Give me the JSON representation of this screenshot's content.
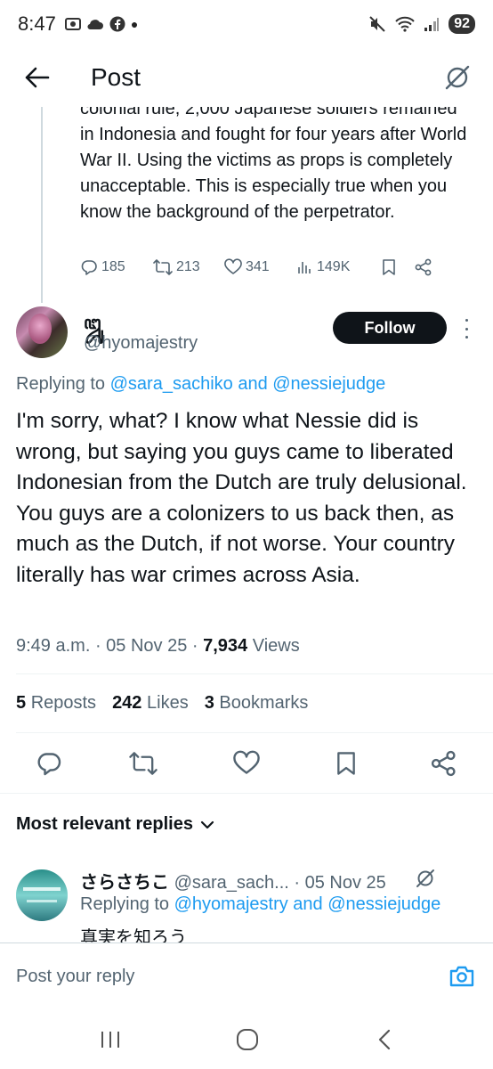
{
  "status_bar": {
    "time": "8:47",
    "battery": "92"
  },
  "header": {
    "title": "Post"
  },
  "previous_post": {
    "text_partial": "colonial rule, 2,000 Japanese soldiers remained in Indonesia and fought for four years after World War II. Using the victims as props is completely unacceptable. This is especially true when you know the background of the perpetrator.",
    "replies": "185",
    "reposts": "213",
    "likes": "341",
    "views": "149K"
  },
  "post": {
    "display_name": "ꦈꦸ",
    "handle": "@hyomajestry",
    "follow_label": "Follow",
    "replying_prefix": "Replying to",
    "replying_users": "@sara_sachiko and @nessiejudge",
    "text": "I'm sorry, what? I know what Nessie did is wrong, but saying you guys came to liberated Indonesian from the Dutch are truly delusional. You guys are a colonizers to us back then, as much as the Dutch, if not worse. Your country literally has war crimes across Asia.",
    "time": "9:49 a.m.",
    "date": "05 Nov 25",
    "views_count": "7,934",
    "views_label": "Views",
    "reposts_count": "5",
    "reposts_label": "Reposts",
    "likes_count": "242",
    "likes_label": "Likes",
    "bookmarks_count": "3",
    "bookmarks_label": "Bookmarks"
  },
  "replies_section": {
    "sort_label": "Most relevant replies"
  },
  "reply": {
    "display_name": "さらさちこ",
    "handle": "@sara_sach...",
    "date": "· 05 Nov 25",
    "replying_prefix": "Replying to",
    "replying_users": "@hyomajestry and @nessiejudge",
    "text": "真実を知ろう"
  },
  "composer": {
    "placeholder": "Post your reply"
  },
  "colors": {
    "accent": "#1d9bf0",
    "text": "#0f1419",
    "secondary": "#536471"
  }
}
